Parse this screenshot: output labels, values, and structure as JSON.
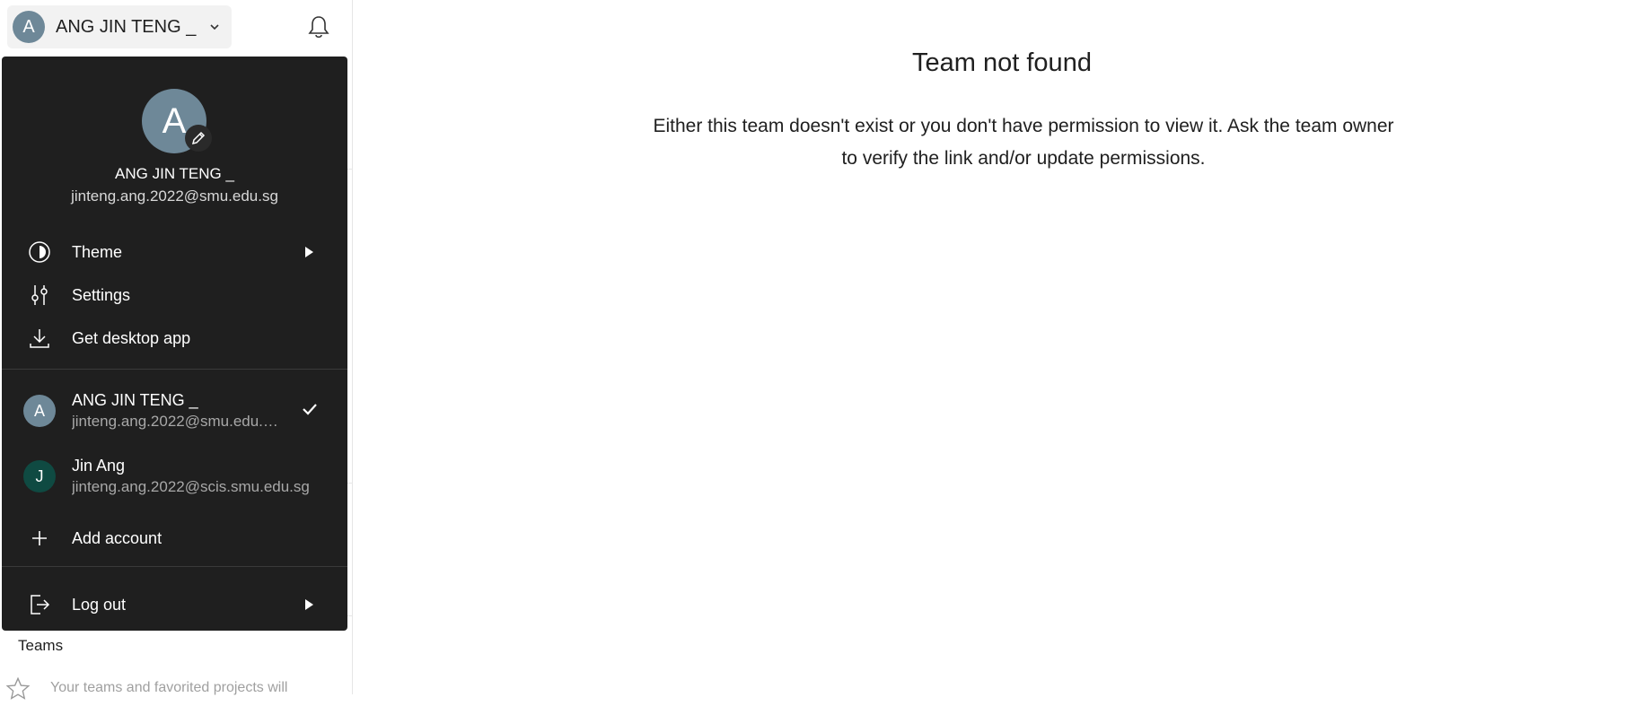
{
  "header": {
    "account_initial": "A",
    "account_name": "ANG JIN TENG _",
    "icons": {
      "chevron": "chevron-down-icon",
      "notifications": "bell-icon"
    }
  },
  "sidebar": {
    "teams_heading": "Teams",
    "teams_empty_text": "Your teams and favorited projects will"
  },
  "main": {
    "title": "Team not found",
    "message_line1": "Either this team doesn't exist or you don't have permission to view it. Ask the team owner",
    "message_line2": "to verify the link and/or update permissions."
  },
  "account_menu": {
    "profile": {
      "initial": "A",
      "name": "ANG JIN TENG _",
      "email": "jinteng.ang.2022@smu.edu.sg"
    },
    "items": [
      {
        "label": "Theme",
        "icon": "theme-icon",
        "has_submenu": true
      },
      {
        "label": "Settings",
        "icon": "settings-sliders-icon",
        "has_submenu": false
      },
      {
        "label": "Get desktop app",
        "icon": "download-icon",
        "has_submenu": false
      }
    ],
    "accounts": [
      {
        "initial": "A",
        "name": "ANG JIN TENG _",
        "email": "jinteng.ang.2022@smu.edu.sg",
        "selected": true,
        "color": "#6e8898"
      },
      {
        "initial": "J",
        "name": "Jin Ang",
        "email": "jinteng.ang.2022@scis.smu.edu.sg",
        "selected": false,
        "color": "#0f4a42"
      }
    ],
    "add_account_label": "Add account",
    "logout_label": "Log out"
  },
  "colors": {
    "menu_background": "#1f1f1f",
    "avatar_gray": "#6e8898",
    "avatar_green": "#0f4a42"
  }
}
